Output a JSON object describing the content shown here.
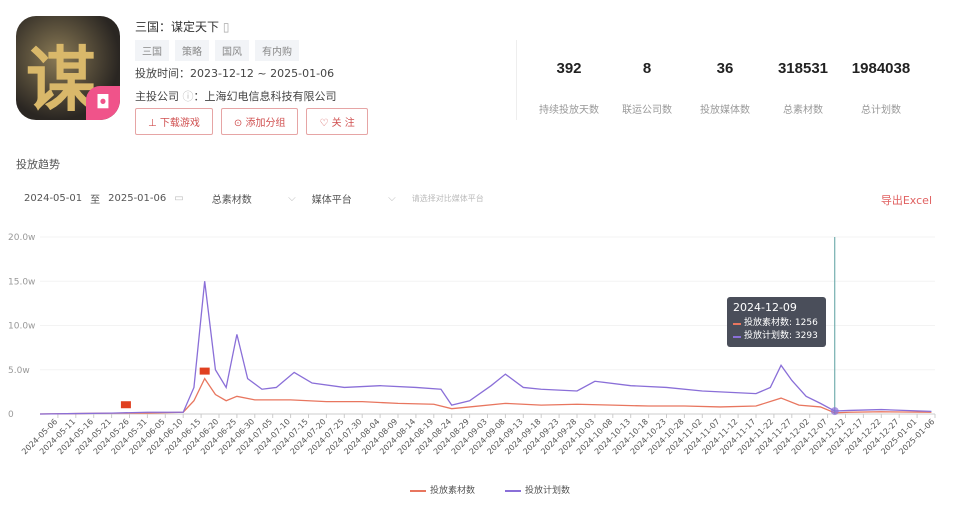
{
  "app": {
    "icon_text": "谋",
    "title": "三国：谋定天下",
    "tags": [
      "三国",
      "策略",
      "国风",
      "有内购"
    ],
    "period_label": "投放时间：",
    "period": "2023-12-12 ~ 2025-01-06",
    "company_label": "主投公司",
    "company": "：上海幻电信息科技有限公司",
    "buttons": {
      "download": "⊥ 下载游戏",
      "add_group": "⊙ 添加分组",
      "follow": "♡ 关 注"
    }
  },
  "stats": [
    {
      "value": "392",
      "label": "持续投放天数"
    },
    {
      "value": "8",
      "label": "联运公司数"
    },
    {
      "value": "36",
      "label": "投放媒体数"
    },
    {
      "value": "318531",
      "label": "总素材数"
    },
    {
      "value": "1984038",
      "label": "总计划数"
    }
  ],
  "section_title": "投放趋势",
  "filters": {
    "start": "2024-05-01",
    "to": "至",
    "end": "2025-01-06",
    "metric": "总素材数",
    "platform": "媒体平台",
    "compare_placeholder": "请选择对比媒体平台"
  },
  "export": "导出Excel",
  "colors": {
    "material": "#e8765f",
    "plan": "#8a6fd8"
  },
  "tooltip": {
    "date": "2024-12-09",
    "rows": [
      {
        "label": "投放素材数: 1256"
      },
      {
        "label": "投放计划数: 3293"
      }
    ]
  },
  "chart_data": {
    "type": "line",
    "y_unit": "w",
    "ylim": [
      0,
      20
    ],
    "yticks": [
      "0",
      "5.0w",
      "10.0w",
      "15.0w",
      "20.0w"
    ],
    "xlim": [
      "2024-05-01",
      "2025-01-06"
    ],
    "xticks": [
      "2024-05-06",
      "2024-05-11",
      "2024-05-16",
      "2024-05-21",
      "2024-05-26",
      "2024-05-31",
      "2024-06-05",
      "2024-06-10",
      "2024-06-15",
      "2024-06-20",
      "2024-06-25",
      "2024-06-30",
      "2024-07-05",
      "2024-07-10",
      "2024-07-15",
      "2024-07-20",
      "2024-07-25",
      "2024-07-30",
      "2024-08-04",
      "2024-08-09",
      "2024-08-14",
      "2024-08-19",
      "2024-08-24",
      "2024-08-29",
      "2024-09-03",
      "2024-09-08",
      "2024-09-13",
      "2024-09-18",
      "2024-09-23",
      "2024-09-28",
      "2024-10-03",
      "2024-10-08",
      "2024-10-13",
      "2024-10-18",
      "2024-10-23",
      "2024-10-28",
      "2024-11-02",
      "2024-11-07",
      "2024-11-12",
      "2024-11-17",
      "2024-11-22",
      "2024-11-27",
      "2024-12-02",
      "2024-12-07",
      "2024-12-12",
      "2024-12-17",
      "2024-12-22",
      "2024-12-27",
      "2025-01-01",
      "2025-01-06"
    ],
    "series": [
      {
        "name": "投放素材数",
        "day": [
          0,
          10,
          20,
          30,
          40,
          43,
          46,
          49,
          52,
          55,
          60,
          70,
          80,
          90,
          100,
          110,
          115,
          120,
          130,
          140,
          150,
          160,
          170,
          180,
          190,
          200,
          207,
          212,
          218,
          222,
          226,
          235,
          249
        ],
        "values": [
          0,
          0.05,
          0.1,
          0.1,
          0.2,
          1.5,
          4,
          2.2,
          1.5,
          2,
          1.6,
          1.6,
          1.4,
          1.4,
          1.2,
          1.1,
          0.6,
          0.8,
          1.2,
          1.0,
          1.1,
          1.0,
          0.9,
          0.9,
          0.8,
          0.9,
          1.8,
          1.0,
          0.8,
          0.13,
          0.2,
          0.25,
          0.2
        ]
      },
      {
        "name": "投放计划数",
        "day": [
          0,
          10,
          20,
          30,
          40,
          43,
          46,
          49,
          52,
          55,
          58,
          62,
          66,
          71,
          76,
          85,
          95,
          105,
          112,
          115,
          120,
          126,
          130,
          135,
          140,
          150,
          155,
          165,
          175,
          185,
          195,
          200,
          204,
          207,
          210,
          214,
          218,
          222,
          226,
          235,
          249
        ],
        "values": [
          0,
          0.05,
          0.1,
          0.2,
          0.2,
          3,
          15,
          5,
          3,
          9,
          4,
          2.8,
          3,
          4.7,
          3.5,
          3,
          3.2,
          3,
          2.8,
          1,
          1.5,
          3.2,
          4.5,
          3,
          2.8,
          2.6,
          3.7,
          3.2,
          3,
          2.6,
          2.4,
          2.3,
          3,
          5.5,
          3.8,
          2,
          1.2,
          0.33,
          0.4,
          0.5,
          0.3
        ]
      }
    ],
    "flags": [
      {
        "day": 24
      },
      {
        "day": 46
      }
    ],
    "cursor_day": 222
  }
}
